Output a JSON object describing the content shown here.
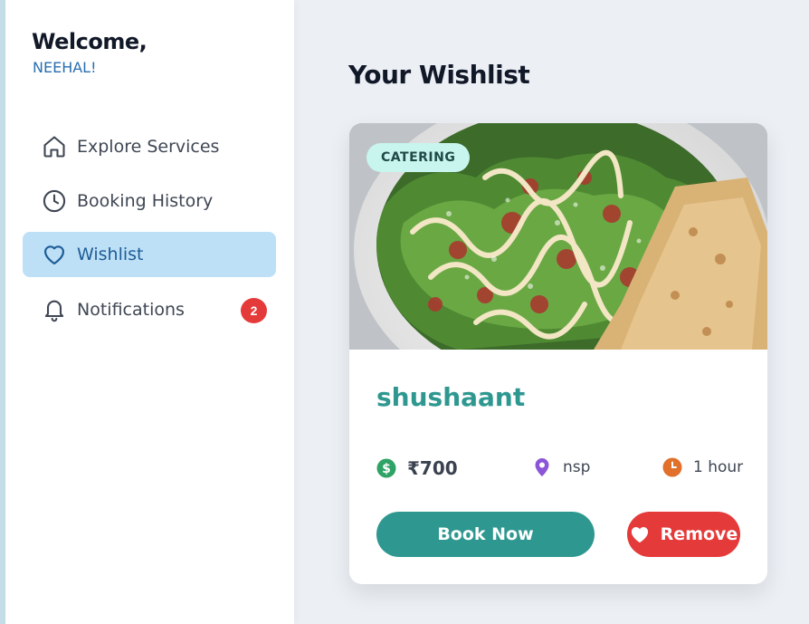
{
  "sidebar": {
    "welcome": "Welcome,",
    "username": "NEEHAL!",
    "items": [
      {
        "label": "Explore Services",
        "icon": "home-icon"
      },
      {
        "label": "Booking History",
        "icon": "clock-icon"
      },
      {
        "label": "Wishlist",
        "icon": "heart-icon"
      },
      {
        "label": "Notifications",
        "icon": "bell-icon",
        "badge": "2"
      }
    ],
    "active_item": "Wishlist"
  },
  "main": {
    "title": "Your Wishlist",
    "card": {
      "category": "CATERING",
      "name": "shushaant",
      "price": "₹700",
      "location": "nsp",
      "duration": "1 hour",
      "book_label": "Book Now",
      "remove_label": "Remove",
      "image": "salad-food-photo"
    }
  },
  "colors": {
    "accent_teal": "#2e9890",
    "remove_red": "#e53a3a",
    "active_nav_bg": "#bde0f7",
    "username_blue": "#2a6eb0",
    "price_icon": "#2fa266",
    "location_icon": "#8a55d8",
    "duration_icon": "#e0702a"
  }
}
